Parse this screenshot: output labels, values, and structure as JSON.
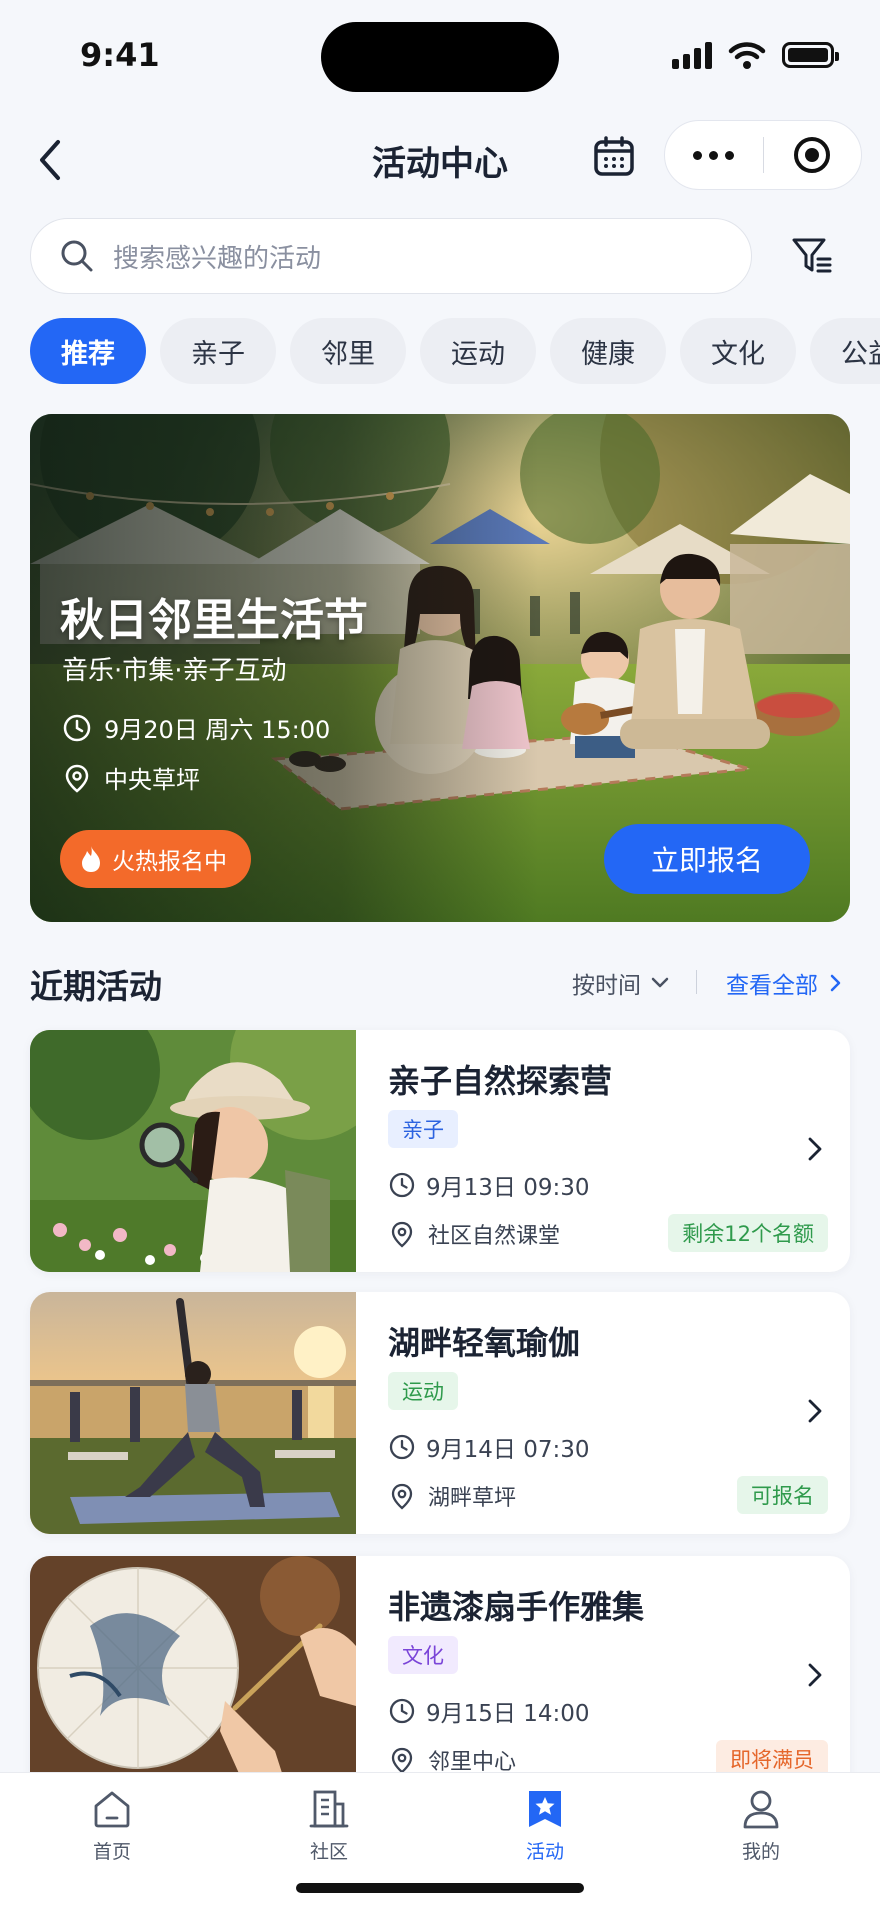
{
  "status_bar": {
    "time": "9:41"
  },
  "nav": {
    "title": "活动中心"
  },
  "search": {
    "placeholder": "搜索感兴趣的活动"
  },
  "categories": [
    "推荐",
    "亲子",
    "邻里",
    "运动",
    "健康",
    "文化",
    "公益"
  ],
  "hero": {
    "title": "秋日邻里生活节",
    "subtitle": "音乐·市集·亲子互动",
    "datetime": "9月20日 周六 15:00",
    "location": "中央草坪",
    "hot_label": "火热报名中",
    "cta_label": "立即报名"
  },
  "section": {
    "title": "近期活动",
    "sort_label": "按时间",
    "view_all_label": "查看全部"
  },
  "activities": [
    {
      "title": "亲子自然探索营",
      "tag": "亲子",
      "time": "9月13日 09:30",
      "place": "社区自然课堂",
      "status": "剩余12个名额"
    },
    {
      "title": "湖畔轻氧瑜伽",
      "tag": "运动",
      "time": "9月14日 07:30",
      "place": "湖畔草坪",
      "status": "可报名"
    },
    {
      "title": "非遗漆扇手作雅集",
      "tag": "文化",
      "time": "9月15日 14:00",
      "place": "邻里中心",
      "status": "即将满员"
    }
  ],
  "tab_bar": [
    {
      "label": "首页",
      "icon": "home-icon"
    },
    {
      "label": "社区",
      "icon": "building-icon"
    },
    {
      "label": "活动",
      "icon": "activity-star-icon"
    },
    {
      "label": "我的",
      "icon": "user-icon"
    }
  ],
  "colors": {
    "primary": "#2367f5",
    "hot": "#f36a2a",
    "tag_family_bg": "#e8efff",
    "tag_family_fg": "#2c63e0",
    "tag_sport_bg": "#e6f6ea",
    "tag_sport_fg": "#2f9a4c",
    "tag_culture_bg": "#f1eafe",
    "tag_culture_fg": "#7a45d8",
    "status_green_bg": "#e6f6ea",
    "status_green_fg": "#2f9a4c",
    "status_orange_bg": "#fdece2",
    "status_orange_fg": "#e5662a"
  }
}
